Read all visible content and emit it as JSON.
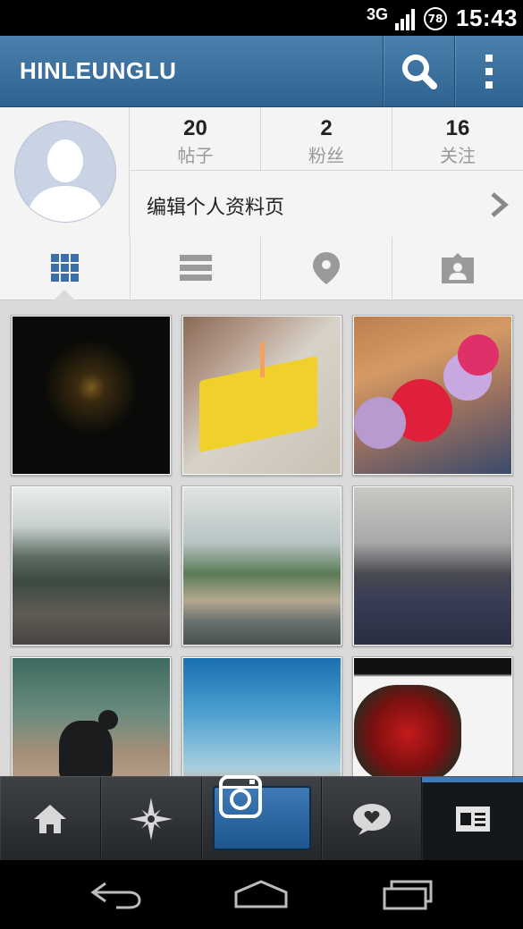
{
  "status_bar": {
    "network": "3G",
    "battery": "78",
    "time": "15:43"
  },
  "header": {
    "title": "HINLEUNGLU",
    "search_icon": "search-icon",
    "more_icon": "overflow-menu-icon"
  },
  "profile": {
    "avatar_icon": "default-avatar-icon",
    "stats": [
      {
        "value": "20",
        "label": "帖子"
      },
      {
        "value": "2",
        "label": "粉丝"
      },
      {
        "value": "16",
        "label": "关注"
      }
    ],
    "edit_label": "编辑个人资料页"
  },
  "view_tabs": [
    {
      "icon": "grid-icon",
      "active": true
    },
    {
      "icon": "list-icon",
      "active": false
    },
    {
      "icon": "location-pin-icon",
      "active": false
    },
    {
      "icon": "tagged-photo-icon",
      "active": false
    }
  ],
  "photos": [
    {
      "subject": "night-river-lights"
    },
    {
      "subject": "birthday-cake"
    },
    {
      "subject": "flowers"
    },
    {
      "subject": "karst-mountains-boats"
    },
    {
      "subject": "river-bank-mountains"
    },
    {
      "subject": "misty-river-dusk"
    },
    {
      "subject": "cormorant-on-rocks"
    },
    {
      "subject": "blue-sky-sunset"
    },
    {
      "subject": "red-blossom-tree"
    }
  ],
  "bottom_tabs": [
    {
      "icon": "home-icon"
    },
    {
      "icon": "explore-icon"
    },
    {
      "icon": "camera-icon"
    },
    {
      "icon": "activity-icon"
    },
    {
      "icon": "profile-icon",
      "active": true
    }
  ],
  "nav_bar": [
    {
      "icon": "back-icon"
    },
    {
      "icon": "home-nav-icon"
    },
    {
      "icon": "recent-apps-icon"
    }
  ],
  "colors": {
    "header": "#3a6f9d",
    "accent": "#3d7ab7",
    "background": "#dadada"
  }
}
